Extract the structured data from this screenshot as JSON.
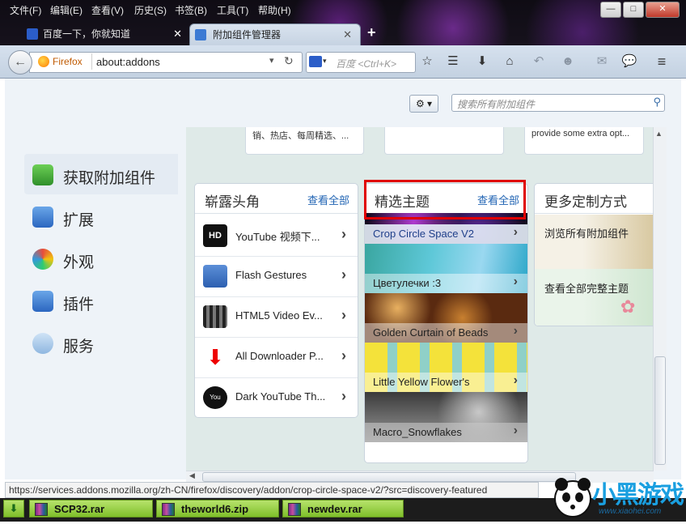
{
  "menu": [
    "文件(F)",
    "编辑(E)",
    "查看(V)",
    "历史(S)",
    "书签(B)",
    "工具(T)",
    "帮助(H)"
  ],
  "window_buttons": {
    "minimize": "—",
    "maximize": "□",
    "close": "✕"
  },
  "tabs": [
    {
      "label": "百度一下，你就知道",
      "active": false
    },
    {
      "label": "附加组件管理器",
      "active": true
    }
  ],
  "new_tab": "+",
  "nav": {
    "identity": "Firefox",
    "url": "about:addons",
    "search_placeholder": "百度 <Ctrl+K>"
  },
  "addons_search_placeholder": "搜索所有附加组件",
  "gear_label": "⚙ ▾",
  "sidebar": [
    {
      "label": "获取附加组件",
      "selected": true,
      "icon": "download-tray-icon"
    },
    {
      "label": "扩展",
      "selected": false,
      "icon": "puzzle-icon"
    },
    {
      "label": "外观",
      "selected": false,
      "icon": "palette-icon"
    },
    {
      "label": "插件",
      "selected": false,
      "icon": "lego-brick-icon"
    },
    {
      "label": "服务",
      "selected": false,
      "icon": "chat-bubble-icon"
    }
  ],
  "top_cards": [
    "销、热店、每周精选、...",
    "",
    "provide some extra opt..."
  ],
  "panels": {
    "rising": {
      "title": "崭露头角",
      "see_all": "查看全部",
      "items": [
        {
          "label": "YouTube 视频下...",
          "icon": "hd-icon"
        },
        {
          "label": "Flash Gestures",
          "icon": "hand-cursor-icon"
        },
        {
          "label": "HTML5 Video Ev...",
          "icon": "film-strip-icon"
        },
        {
          "label": "All Downloader P...",
          "icon": "red-down-arrow-icon"
        },
        {
          "label": "Dark YouTube Th...",
          "icon": "youtube-icon"
        }
      ]
    },
    "themes": {
      "title": "精选主题",
      "see_all": "查看全部",
      "items": [
        {
          "label": "Crop Circle Space V2"
        },
        {
          "label": "Цветулечки :3"
        },
        {
          "label": "Golden Curtain of Beads"
        },
        {
          "label": "Little Yellow Flower's"
        },
        {
          "label": "Macro_Snowflakes"
        }
      ]
    },
    "more": {
      "title": "更多定制方式",
      "items": [
        {
          "label": "浏览所有附加组件"
        },
        {
          "label": "查看全部完整主题"
        }
      ]
    }
  },
  "status_url": "https://services.addons.mozilla.org/zh-CN/firefox/discovery/addon/crop-circle-space-v2/?src=discovery-featured",
  "downloads": [
    "SCP32.rar",
    "theworld6.zip",
    "newdev.rar"
  ],
  "watermark": {
    "text": "小黑游戏",
    "site": "www.xiaohei.com"
  },
  "colors": {
    "accent_link": "#2265b4",
    "highlight_box": "#e00000",
    "download_green": "#8cc63f"
  }
}
